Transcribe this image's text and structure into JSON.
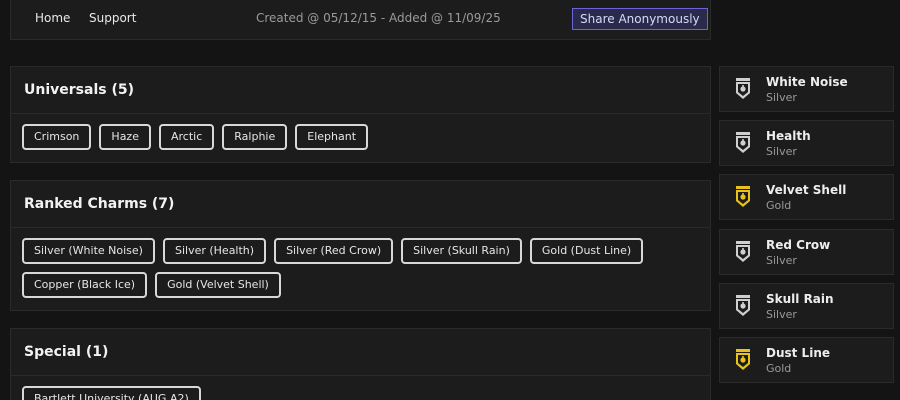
{
  "nav": {
    "home": "Home",
    "support": "Support",
    "created": "Created @ 05/12/15 - Added @ 11/09/25",
    "share": "Share Anonymously"
  },
  "universals": {
    "title": "Universals (5)",
    "items": [
      "Crimson",
      "Haze",
      "Arctic",
      "Ralphie",
      "Elephant"
    ]
  },
  "ranked": {
    "title": "Ranked Charms (7)",
    "items": [
      "Silver (White Noise)",
      "Silver (Health)",
      "Silver (Red Crow)",
      "Silver (Skull Rain)",
      "Gold (Dust Line)",
      "Copper (Black Ice)",
      "Gold (Velvet Shell)"
    ]
  },
  "special": {
    "title": "Special (1)",
    "items": [
      "Bartlett University (AUG A2)"
    ]
  },
  "charms": [
    {
      "name": "White Noise",
      "tier": "Silver",
      "color": "#cfcfcf"
    },
    {
      "name": "Health",
      "tier": "Silver",
      "color": "#cfcfcf"
    },
    {
      "name": "Velvet Shell",
      "tier": "Gold",
      "color": "#e8c21c"
    },
    {
      "name": "Red Crow",
      "tier": "Silver",
      "color": "#cfcfcf"
    },
    {
      "name": "Skull Rain",
      "tier": "Silver",
      "color": "#cfcfcf"
    },
    {
      "name": "Dust Line",
      "tier": "Gold",
      "color": "#e8c21c"
    }
  ],
  "icon_name": "rank-shield-icon"
}
